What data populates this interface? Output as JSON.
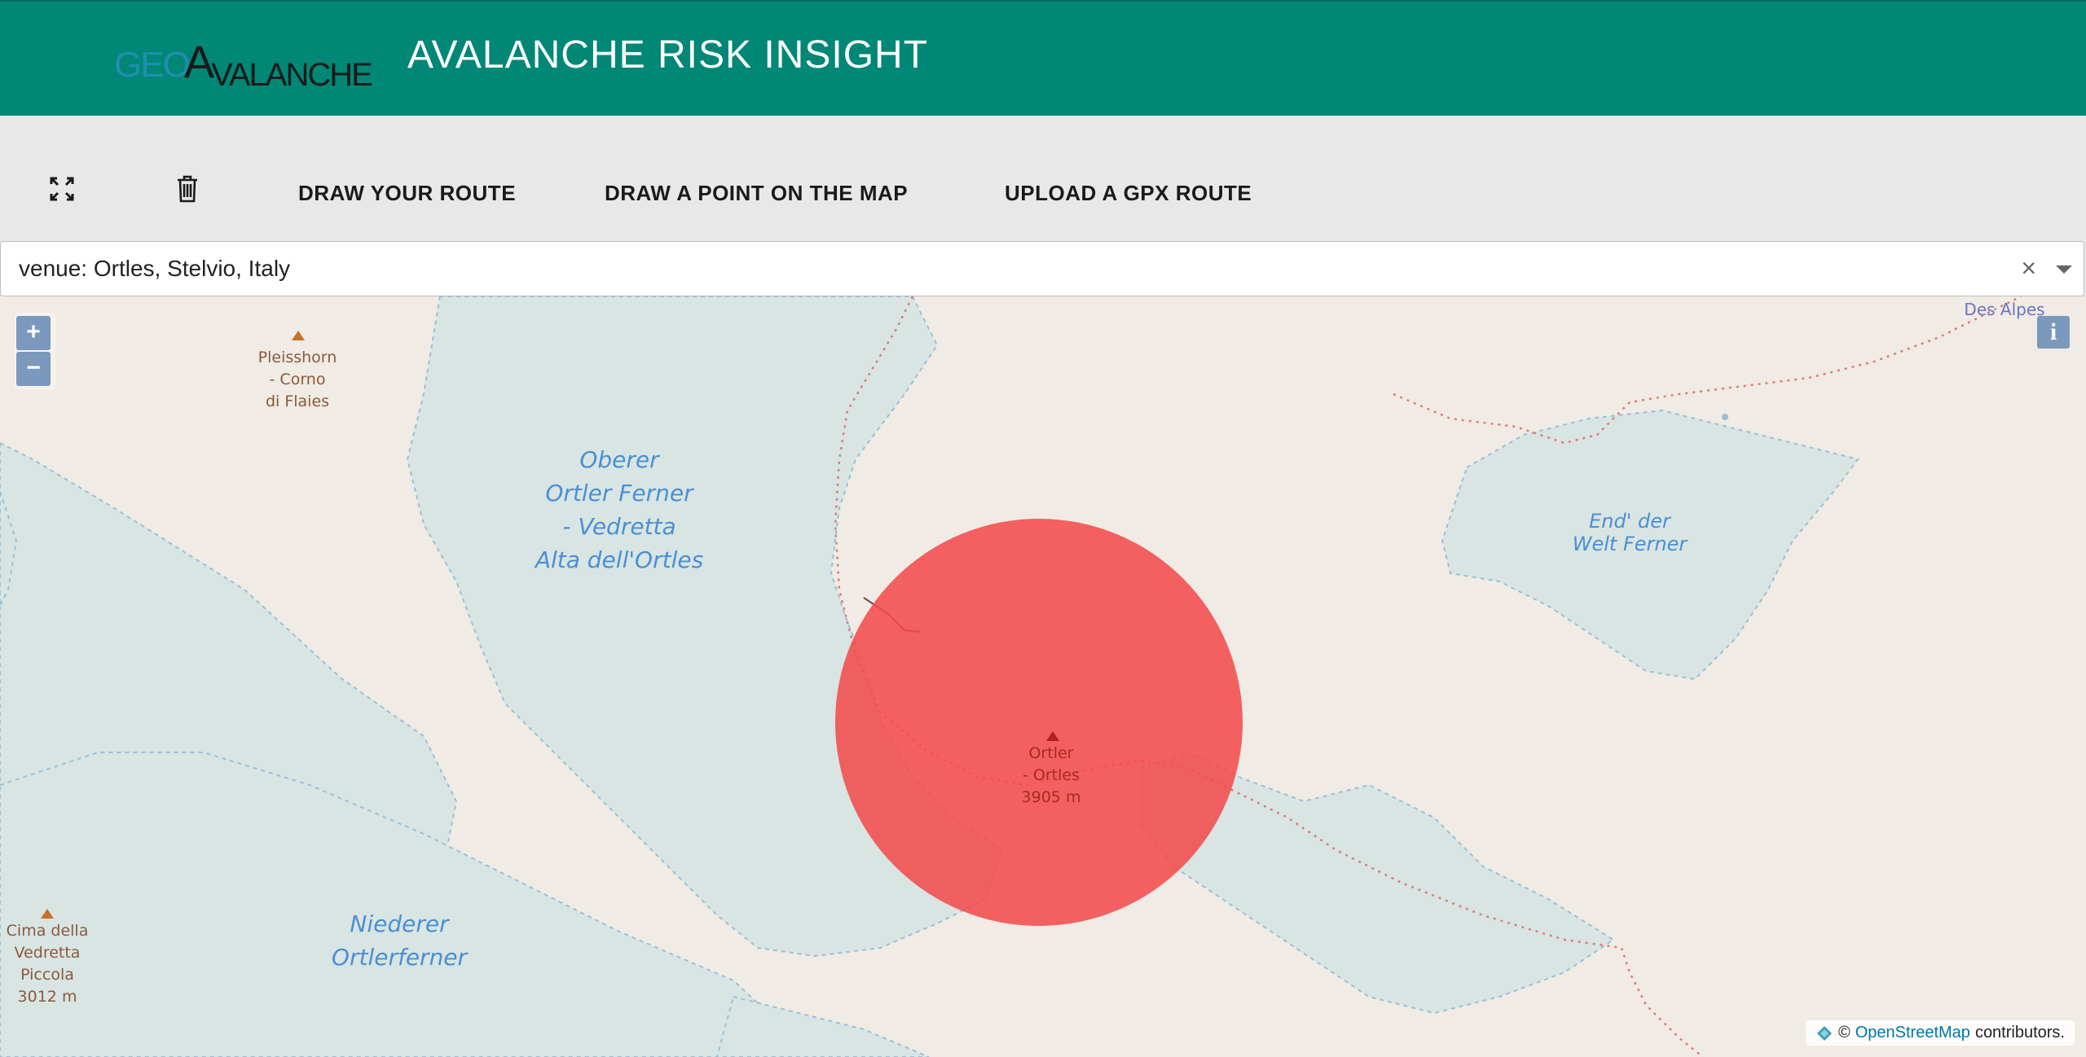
{
  "header": {
    "logo_geo": "GEO",
    "logo_a": "A",
    "logo_rest": "VALANCHE",
    "title": "AVALANCHE RISK INSIGHT"
  },
  "toolbar": {
    "fullscreen_icon": "expand-icon",
    "delete_icon": "trash-icon",
    "draw_route": "DRAW YOUR ROUTE",
    "draw_point": "DRAW A POINT ON THE MAP",
    "upload_gpx": "UPLOAD A GPX ROUTE"
  },
  "search": {
    "value": "venue: Ortles, Stelvio, Italy",
    "clear": "×"
  },
  "map": {
    "zoom_in": "+",
    "zoom_out": "−",
    "info": "i",
    "labels": {
      "pleisshorn": [
        "Pleisshorn",
        "- Corno",
        "di Flaies"
      ],
      "oberer": [
        "Oberer",
        "Ortler Ferner",
        "- Vedretta",
        "Alta dell'Ortles"
      ],
      "ortler": [
        "Ortler",
        "- Ortles",
        "3905 m"
      ],
      "niederer": [
        "Niederer",
        "Ortlerferner"
      ],
      "cima": [
        "Cima della",
        "Vedretta",
        "Piccola",
        "3012 m"
      ],
      "end_der": [
        "End' der",
        "Welt Ferner"
      ],
      "des_alpes": "Des Alpes"
    },
    "attribution_prefix": "©",
    "attribution_link": "OpenStreetMap",
    "attribution_suffix": "contributors."
  },
  "colors": {
    "header": "#008775",
    "glacier": "#d9e6e4",
    "land": "#f0ebe4",
    "risk_circle": "#f24c4c"
  }
}
